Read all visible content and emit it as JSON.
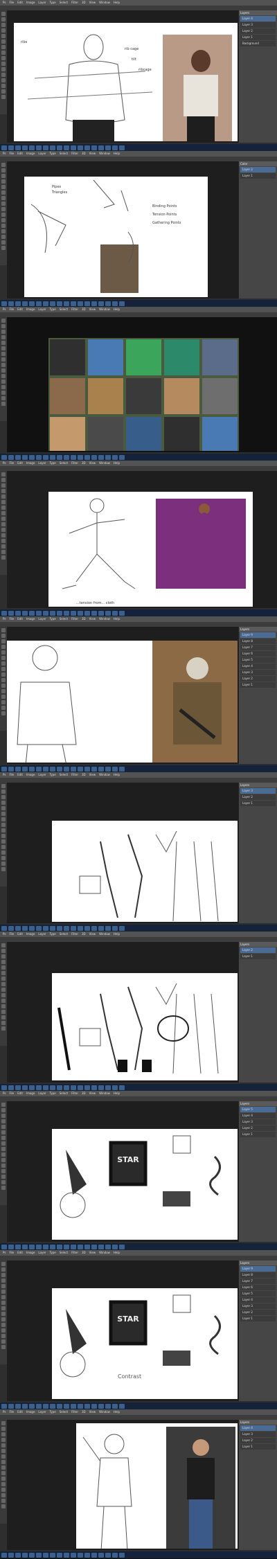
{
  "app": {
    "menu": [
      "Ps",
      "File",
      "Edit",
      "Image",
      "Layer",
      "Type",
      "Select",
      "Filter",
      "3D",
      "View",
      "Window",
      "Help"
    ]
  },
  "frames": [
    {
      "id": "frame-1",
      "canvas_notes": [
        "ribs",
        "rib cage",
        "tilt",
        "ribcage"
      ],
      "panel_title": "Layers",
      "layers": [
        "Layer 4",
        "Layer 3",
        "Layer 2",
        "Layer 1",
        "Background"
      ],
      "photo": "model-lace-top"
    },
    {
      "id": "frame-2",
      "canvas_notes": [
        "Pipes",
        "Triangles",
        "Binding Points",
        "Tension Points",
        "Gathering Points"
      ],
      "panel_title": "Color",
      "layers": [
        "Layer 2",
        "Layer 1"
      ],
      "photo": "fabric-fold"
    },
    {
      "id": "frame-3",
      "canvas_notes": [],
      "panel_title": "",
      "layers": [],
      "photo": "shorts-collage"
    },
    {
      "id": "frame-4",
      "canvas_notes": [
        "...tension from... cloth"
      ],
      "panel_title": "",
      "layers": [],
      "photo": "kung-fu-purple"
    },
    {
      "id": "frame-5",
      "canvas_notes": [],
      "panel_title": "Layers",
      "layers": [
        "Layer 9",
        "Layer 8",
        "Layer 7",
        "Layer 6",
        "Layer 5",
        "Layer 4",
        "Layer 3",
        "Layer 2",
        "Layer 1"
      ],
      "photo": "soldier-gear"
    },
    {
      "id": "frame-6",
      "canvas_notes": [],
      "panel_title": "Layers",
      "layers": [
        "Layer 3",
        "Layer 2",
        "Layer 1"
      ],
      "photo": ""
    },
    {
      "id": "frame-7",
      "canvas_notes": [],
      "panel_title": "Layers",
      "layers": [
        "Layer 2",
        "Layer 1"
      ],
      "photo": ""
    },
    {
      "id": "frame-8",
      "canvas_notes": [
        "STAR"
      ],
      "panel_title": "Layers",
      "layers": [
        "Layer 5",
        "Layer 4",
        "Layer 3",
        "Layer 2",
        "Layer 1"
      ],
      "photo": ""
    },
    {
      "id": "frame-9",
      "canvas_notes": [
        "STAR",
        "Contrast"
      ],
      "panel_title": "Layers",
      "layers": [
        "Layer 9",
        "Layer 8",
        "Layer 7",
        "Layer 6",
        "Layer 5",
        "Layer 4",
        "Layer 3",
        "Layer 2",
        "Layer 1"
      ],
      "photo": ""
    },
    {
      "id": "frame-10",
      "canvas_notes": [],
      "panel_title": "Layers",
      "layers": [
        "Layer 4",
        "Layer 3",
        "Layer 2",
        "Layer 1"
      ],
      "photo": "man-leather-jacket"
    }
  ]
}
